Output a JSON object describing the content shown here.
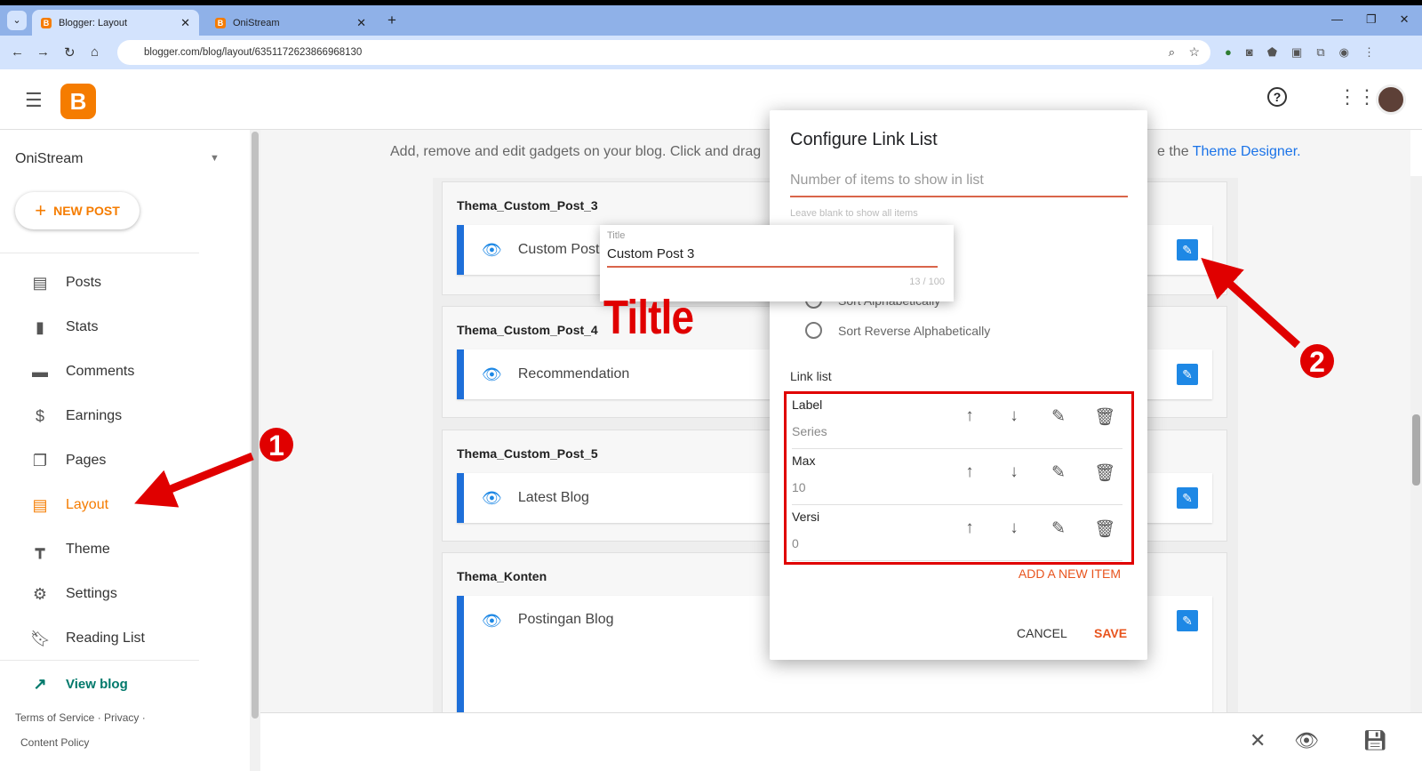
{
  "browser": {
    "tabs": [
      {
        "title": "Blogger: Layout"
      },
      {
        "title": "OniStream"
      }
    ],
    "url": "blogger.com/blog/layout/6351172623866968130"
  },
  "sidebar": {
    "blog_name": "OniStream",
    "new_post": "NEW POST",
    "items": [
      {
        "label": "Posts",
        "icon": "posts-icon"
      },
      {
        "label": "Stats",
        "icon": "stats-icon"
      },
      {
        "label": "Comments",
        "icon": "comments-icon"
      },
      {
        "label": "Earnings",
        "icon": "dollar-icon"
      },
      {
        "label": "Pages",
        "icon": "pages-icon"
      },
      {
        "label": "Layout",
        "icon": "layout-icon",
        "active": true
      },
      {
        "label": "Theme",
        "icon": "theme-icon"
      },
      {
        "label": "Settings",
        "icon": "gear-icon"
      },
      {
        "label": "Reading List",
        "icon": "bookmark-icon"
      }
    ],
    "view_blog": "View blog",
    "footer": {
      "terms": "Terms of Service",
      "privacy": "Privacy",
      "content_policy": "Content Policy"
    }
  },
  "main": {
    "intro": "Add, remove and edit gadgets on your blog. Click and drag",
    "intro_end": "e the",
    "theme_designer": "Theme Designer.",
    "groups": [
      {
        "title": "Thema_Custom_Post_3",
        "gadget": "Custom Post"
      },
      {
        "title": "Thema_Custom_Post_4",
        "gadget": "Recommendation"
      },
      {
        "title": "Thema_Custom_Post_5",
        "gadget": "Latest Blog"
      },
      {
        "title": "Thema_Konten",
        "gadget": "Postingan Blog"
      }
    ]
  },
  "dialog": {
    "title": "Configure Link List",
    "items_placeholder": "Number of items to show in list",
    "items_hint": "Leave blank to show all items",
    "sort_alpha": "Sort Alphabetically",
    "sort_reverse": "Sort Reverse Alphabetically",
    "link_list_label": "Link list",
    "links": [
      {
        "label": "Label",
        "value": "Series"
      },
      {
        "label": "Max",
        "value": "10"
      },
      {
        "label": "Versi",
        "value": "0"
      }
    ],
    "add_item": "ADD A NEW ITEM",
    "cancel": "CANCEL",
    "save": "SAVE"
  },
  "title_popup": {
    "label": "Title",
    "value": "Custom Post 3",
    "counter": "13 / 100"
  },
  "annotations": {
    "title_note": "Tiltle",
    "step1": "1",
    "step2": "2"
  },
  "colors": {
    "accent": "#f57c00",
    "link_blue": "#1a73e8",
    "annotation_red": "#e00000",
    "save_orange": "#e8541e"
  }
}
